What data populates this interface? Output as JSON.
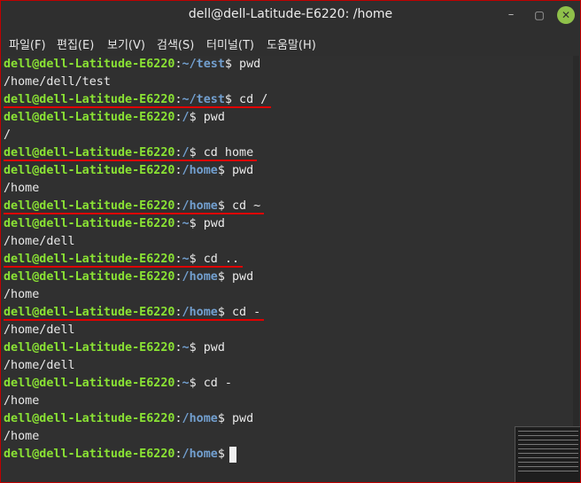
{
  "window": {
    "title": "dell@dell-Latitude-E6220: /home",
    "controls": {
      "minimize": "–",
      "maximize": "▢",
      "close": "✕"
    }
  },
  "menu": {
    "items": [
      "파일(F)",
      "편집(E)",
      "보기(V)",
      "검색(S)",
      "터미널(T)",
      "도움말(H)"
    ]
  },
  "terminal": {
    "prompt_user": "dell@dell-Latitude-E6220",
    "lines": [
      {
        "type": "prompt",
        "path": "~/test",
        "cmd": " pwd",
        "underline": false
      },
      {
        "type": "output",
        "text": "/home/dell/test"
      },
      {
        "type": "prompt",
        "path": "~/test",
        "cmd": " cd /",
        "underline": true
      },
      {
        "type": "prompt",
        "path": "/",
        "cmd": " pwd",
        "underline": false
      },
      {
        "type": "output",
        "text": "/"
      },
      {
        "type": "prompt",
        "path": "/",
        "cmd": " cd home",
        "underline": true
      },
      {
        "type": "prompt",
        "path": "/home",
        "cmd": " pwd",
        "underline": false
      },
      {
        "type": "output",
        "text": "/home"
      },
      {
        "type": "prompt",
        "path": "/home",
        "cmd": " cd ~",
        "underline": true
      },
      {
        "type": "prompt",
        "path": "~",
        "cmd": " pwd",
        "underline": false
      },
      {
        "type": "output",
        "text": "/home/dell"
      },
      {
        "type": "prompt",
        "path": "~",
        "cmd": " cd ..",
        "underline": true
      },
      {
        "type": "prompt",
        "path": "/home",
        "cmd": " pwd",
        "underline": false
      },
      {
        "type": "output",
        "text": "/home"
      },
      {
        "type": "prompt",
        "path": "/home",
        "cmd": " cd -",
        "underline": true
      },
      {
        "type": "output",
        "text": "/home/dell"
      },
      {
        "type": "prompt",
        "path": "~",
        "cmd": " pwd",
        "underline": false
      },
      {
        "type": "output",
        "text": "/home/dell"
      },
      {
        "type": "prompt",
        "path": "~",
        "cmd": " cd -",
        "underline": false
      },
      {
        "type": "output",
        "text": "/home"
      },
      {
        "type": "prompt",
        "path": "/home",
        "cmd": " pwd",
        "underline": false
      },
      {
        "type": "output",
        "text": "/home"
      },
      {
        "type": "prompt",
        "path": "/home",
        "cmd": " ",
        "underline": false
      }
    ]
  },
  "colors": {
    "user": "#8ae234",
    "path": "#729fcf",
    "underline": "#e00000",
    "background": "#303030"
  }
}
